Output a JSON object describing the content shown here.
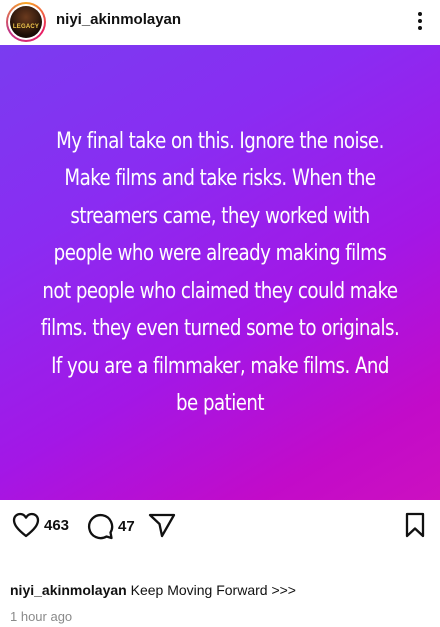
{
  "header": {
    "username": "niyi_akinmolayan",
    "avatar_text": "LEGACY"
  },
  "post": {
    "text": "My final take on this. Ignore the noise. Make films and take risks. When the streamers came, they worked with people who were already making films not people who claimed they could make films. they  even turned some to originals. If you are a filmmaker, make films. And be patient",
    "background_colors": [
      "#7a3cf0",
      "#a317e6",
      "#cc10c0"
    ]
  },
  "actions": {
    "like_count": "463",
    "comment_count": "47",
    "like_icon": "heart-icon",
    "comment_icon": "comment-icon",
    "share_icon": "send-icon",
    "save_icon": "bookmark-icon"
  },
  "caption": {
    "username": "niyi_akinmolayan",
    "text": "Keep Moving Forward >>>"
  },
  "timestamp": "1 hour ago"
}
